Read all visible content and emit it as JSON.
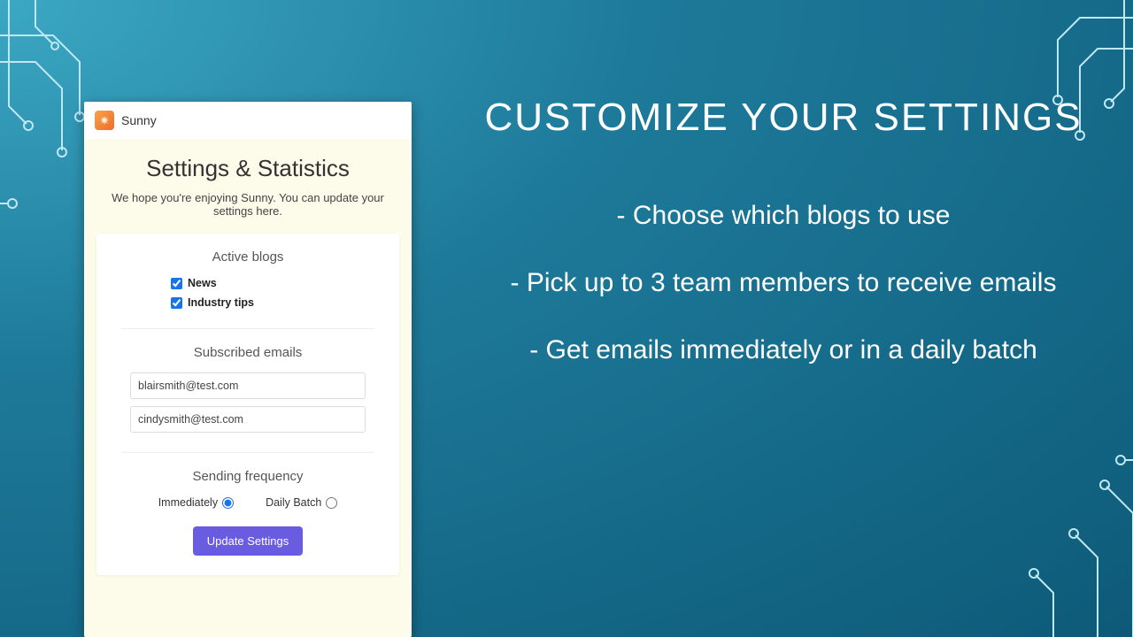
{
  "app": {
    "name": "Sunny"
  },
  "settings": {
    "title": "Settings & Statistics",
    "subtitle": "We hope you're enjoying Sunny. You can update your settings here.",
    "active_blogs": {
      "heading": "Active blogs",
      "items": [
        {
          "label": "News",
          "checked": true
        },
        {
          "label": "Industry tips",
          "checked": true
        }
      ]
    },
    "subscribed_emails": {
      "heading": "Subscribed emails",
      "values": [
        "blairsmith@test.com",
        "cindysmith@test.com"
      ]
    },
    "sending_frequency": {
      "heading": "Sending frequency",
      "options": [
        {
          "label": "Immediately",
          "selected": true
        },
        {
          "label": "Daily Batch",
          "selected": false
        }
      ]
    },
    "update_button": "Update Settings"
  },
  "slide": {
    "title": "CUSTOMIZE YOUR SETTINGS",
    "bullets": [
      "Choose which blogs to use",
      "Pick up to 3 team members to receive emails",
      "Get emails immediately or in a daily batch"
    ]
  },
  "colors": {
    "accent": "#6a5ce0",
    "check": "#1a73e8"
  }
}
